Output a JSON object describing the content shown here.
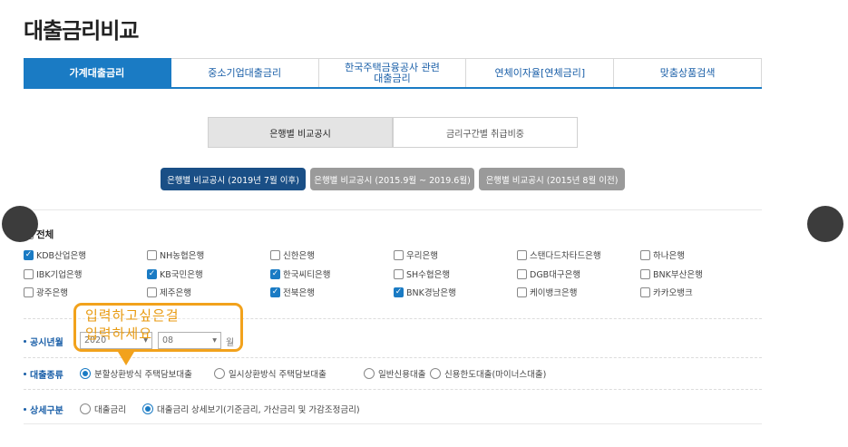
{
  "page_title": "대출금리비교",
  "tabs": [
    {
      "label": "가계대출금리",
      "active": true
    },
    {
      "label": "중소기업대출금리"
    },
    {
      "label": "한국주택금융공사 관련\n대출금리"
    },
    {
      "label": "연체이자율[연체금리]"
    },
    {
      "label": "맞춤상품검색"
    }
  ],
  "segments": [
    "은행별 비교공시",
    "금리구간별 취급비중"
  ],
  "periods": [
    "은행별 비교공시 (2019년 7월 이후)",
    "은행별 비교공시 (2015.9월 ~ 2019.6월)",
    "은행별 비교공시 (2015년 8월 이전)"
  ],
  "all_label": "전체",
  "banks": [
    {
      "name": "KDB산업은행",
      "checked": true
    },
    {
      "name": "NH농협은행",
      "checked": false
    },
    {
      "name": "신한은행",
      "checked": false
    },
    {
      "name": "우리은행",
      "checked": false
    },
    {
      "name": "스탠다드차타드은행",
      "checked": false
    },
    {
      "name": "하나은행",
      "checked": false
    },
    {
      "name": "IBK기업은행",
      "checked": false
    },
    {
      "name": "KB국민은행",
      "checked": true
    },
    {
      "name": "한국씨티은행",
      "checked": true
    },
    {
      "name": "SH수협은행",
      "checked": false
    },
    {
      "name": "DGB대구은행",
      "checked": false
    },
    {
      "name": "BNK부산은행",
      "checked": false
    },
    {
      "name": "광주은행",
      "checked": false
    },
    {
      "name": "제주은행",
      "checked": false
    },
    {
      "name": "전북은행",
      "checked": true
    },
    {
      "name": "BNK경남은행",
      "checked": true
    },
    {
      "name": "케이뱅크은행",
      "checked": false
    },
    {
      "name": "카카오뱅크",
      "checked": false
    }
  ],
  "form": {
    "date_label": "공시년월",
    "year_value": "2020",
    "month_value": "08",
    "month_unit": "월",
    "loan_type_label": "대출종류",
    "loan_types": [
      {
        "label": "분할상환방식 주택담보대출",
        "selected": true
      },
      {
        "label": "일시상환방식 주택담보대출",
        "selected": false
      },
      {
        "label": "일반신용대출",
        "selected": false
      },
      {
        "label": "신용한도대출(마이너스대출)",
        "selected": false
      }
    ],
    "detail_label": "상세구분",
    "details": [
      {
        "label": "대출금리",
        "selected": false
      },
      {
        "label": "대출금리 상세보기(기준금리, 가산금리 및 가감조정금리)",
        "selected": true
      }
    ]
  },
  "callout_text": "입력하고싶은걸\n입력하세요",
  "colors": {
    "accent": "#1a7bc4",
    "dark_button": "#1a4f86",
    "gray_button": "#9a9a9a",
    "callout": "#f2a21c"
  }
}
